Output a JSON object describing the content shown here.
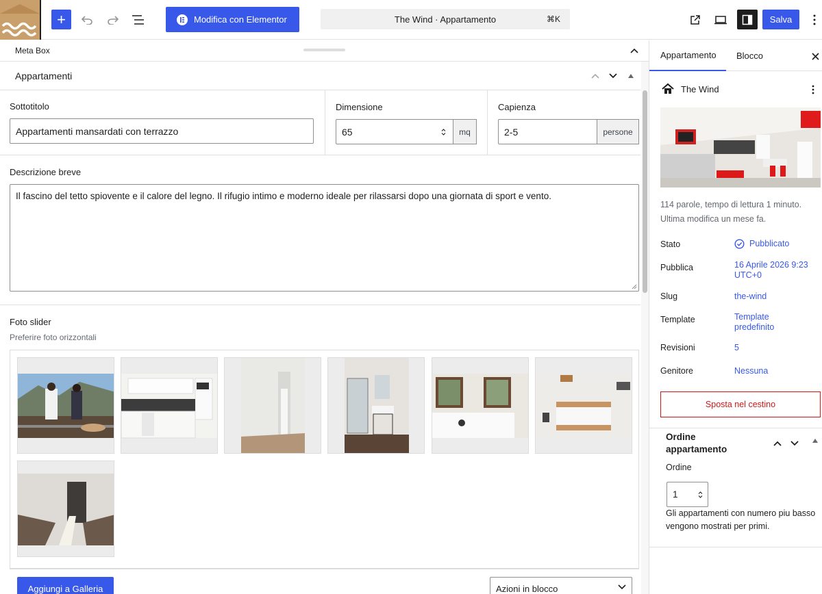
{
  "toolbar": {
    "elementor_label": "Modifica con Elementor",
    "command_text": "The Wind · Appartamento",
    "command_shortcut": "⌘K",
    "save_label": "Salva"
  },
  "metabox": {
    "title": "Meta Box"
  },
  "panel": {
    "title": "Appartamenti",
    "fields": {
      "sottotitolo": {
        "label": "Sottotitolo",
        "value": "Appartamenti mansardati con terrazzo"
      },
      "dimensione": {
        "label": "Dimensione",
        "value": "65",
        "unit": "mq"
      },
      "capienza": {
        "label": "Capienza",
        "value": "2-5",
        "unit": "persone"
      },
      "descrizione": {
        "label": "Descrizione breve",
        "value": "Il fascino del tetto spiovente e il calore del legno. Il rifugio intimo e moderno ideale per rilassarsi dopo una giornata di sport e vento."
      },
      "foto_slider": {
        "label": "Foto slider",
        "hint": "Preferire foto orizzontali"
      }
    },
    "gallery": {
      "add_button": "Aggiungi a Galleria",
      "bulk_actions": "Azioni in blocco"
    }
  },
  "sidebar": {
    "tabs": [
      "Appartamento",
      "Blocco"
    ],
    "post_title": "The Wind",
    "meta_line1": "114 parole, tempo di lettura 1 minuto.",
    "meta_line2": "Ultima modifica un mese fa.",
    "rows": [
      {
        "label": "Stato",
        "value": "Pubblicato"
      },
      {
        "label": "Pubblica",
        "value": "16 Aprile 2026 9:23 UTC+0"
      },
      {
        "label": "Slug",
        "value": "the-wind"
      },
      {
        "label": "Template",
        "value": "Template predefinito"
      },
      {
        "label": "Revisioni",
        "value": "5"
      },
      {
        "label": "Genitore",
        "value": "Nessuna"
      }
    ],
    "trash_label": "Sposta nel cestino",
    "order_panel": {
      "title": "Ordine appartamento",
      "field_label": "Ordine",
      "value": "1",
      "help": "Gli appartamenti con numero piu basso vengono mostrati per primi."
    }
  },
  "colors": {
    "accent": "#3858e9",
    "danger": "#cc1818",
    "dark": "#1e1e1e"
  }
}
